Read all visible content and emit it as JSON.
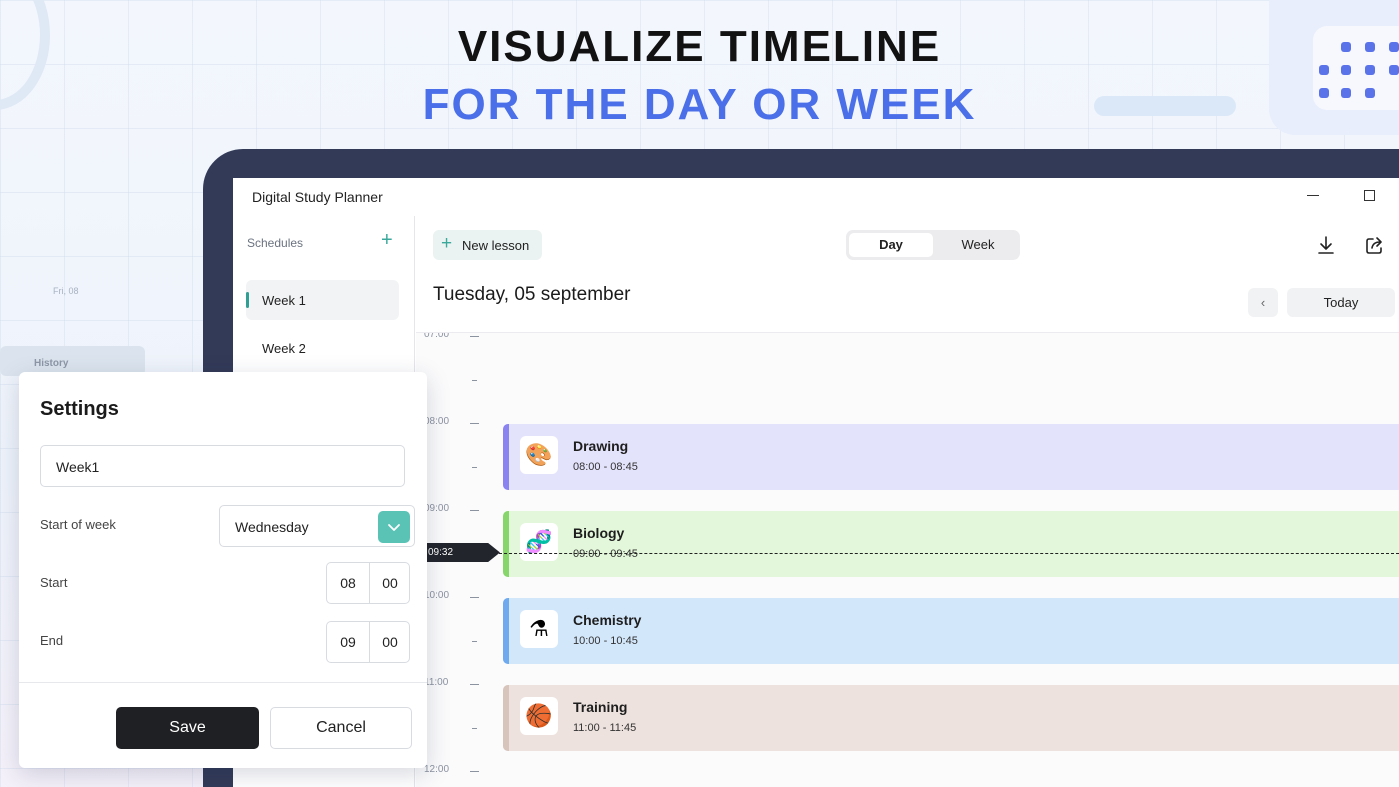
{
  "headline": {
    "line1": "VISUALIZE TIMELINE",
    "line2": "FOR THE DAY OR WEEK"
  },
  "background": {
    "day_label": "Fri, 08",
    "history_label": "History"
  },
  "app": {
    "title": "Digital Study Planner"
  },
  "sidebar": {
    "header": "Schedules",
    "items": [
      {
        "label": "Week 1",
        "active": true
      },
      {
        "label": "Week 2",
        "active": false
      }
    ]
  },
  "toolbar": {
    "new_lesson_label": "New lesson",
    "view_tabs": [
      {
        "label": "Day",
        "selected": true
      },
      {
        "label": "Week",
        "selected": false
      }
    ],
    "today_label": "Today",
    "icons": [
      "download-icon",
      "share-icon",
      "chevron-left-icon"
    ]
  },
  "date_title": "Tuesday, 05 september",
  "timeline": {
    "hours": [
      "07:00",
      "08:00",
      "09:00",
      "10:00",
      "11:00",
      "12:00"
    ],
    "current_time": "09:32",
    "events": [
      {
        "name": "Drawing",
        "time": "08:00 - 08:45",
        "icon": "palette-icon",
        "color": "#e4e3fc",
        "stripe": "#8a83f0"
      },
      {
        "name": "Biology",
        "time": "09:00 - 09:45",
        "icon": "dna-icon",
        "color": "#e3f7da",
        "stripe": "#86d66b"
      },
      {
        "name": "Chemistry",
        "time": "10:00 - 10:45",
        "icon": "flask-icon",
        "color": "#d3e7fb",
        "stripe": "#6fa9ee"
      },
      {
        "name": "Training",
        "time": "11:00 - 11:45",
        "icon": "basketball-icon",
        "color": "#ede2dd",
        "stripe": "#d7c5bc"
      }
    ]
  },
  "settings": {
    "title": "Settings",
    "name_value": "Week1",
    "start_of_week_label": "Start of week",
    "start_of_week_value": "Wednesday",
    "start_label": "Start",
    "start_hour": "08",
    "start_minute": "00",
    "end_label": "End",
    "end_hour": "09",
    "end_minute": "00",
    "save_label": "Save",
    "cancel_label": "Cancel"
  }
}
